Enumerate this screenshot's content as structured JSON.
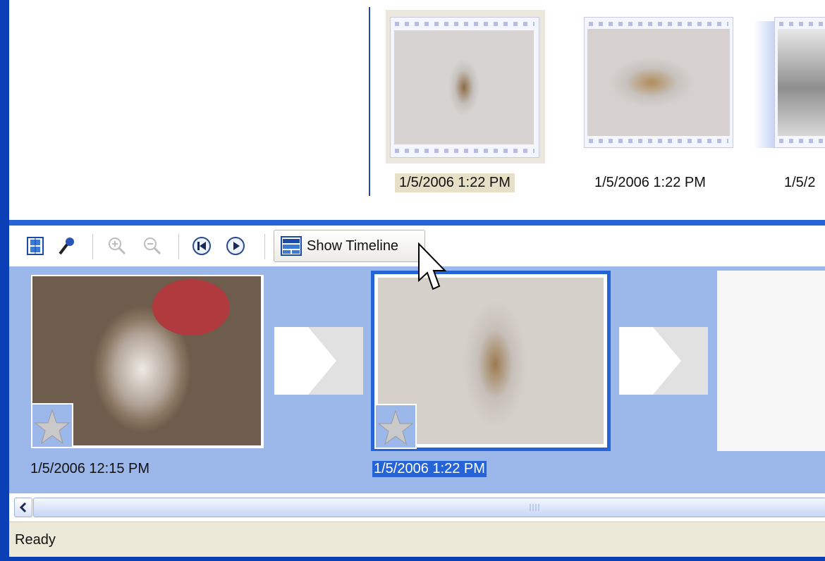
{
  "collection": {
    "items": [
      {
        "label": "1/5/2006 1:22 PM",
        "selected": true
      },
      {
        "label": "1/5/2006 1:22 PM",
        "selected": false
      },
      {
        "label": "1/5/2"
      }
    ]
  },
  "toolbar": {
    "icons": [
      "storyboard-view-icon",
      "narrate-microphone-icon",
      "zoom-in-icon",
      "zoom-out-icon",
      "rewind-icon",
      "play-icon"
    ],
    "show_timeline_label": "Show Timeline"
  },
  "storyboard": {
    "clips": [
      {
        "label": "1/5/2006 12:15 PM",
        "selected": false
      },
      {
        "label": "1/5/2006 1:22 PM",
        "selected": true
      }
    ]
  },
  "status": {
    "text": "Ready"
  },
  "colors": {
    "window_border": "#0b3fb5",
    "storyboard_bg": "#9cb7ea",
    "selection": "#2563d6",
    "status_bg": "#ece9d8"
  }
}
